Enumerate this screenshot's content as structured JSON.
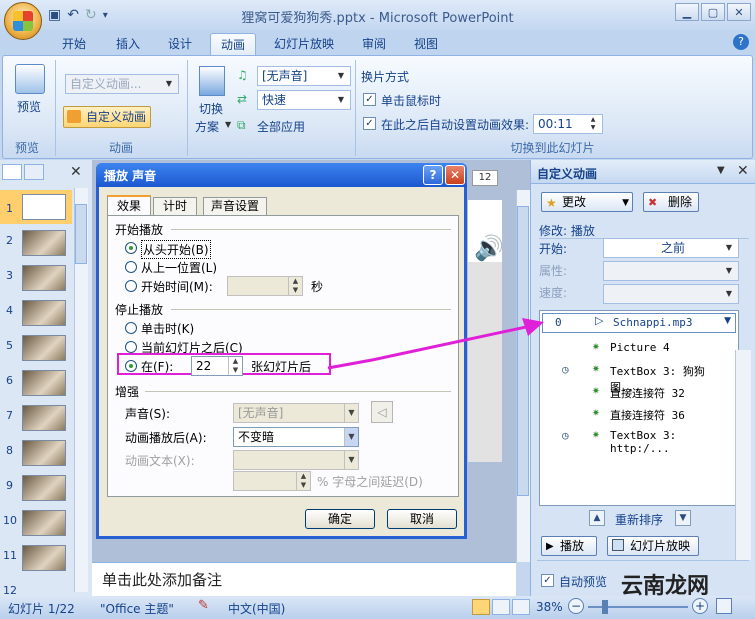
{
  "window": {
    "title": "狸窝可爱狗狗秀.pptx - Microsoft PowerPoint"
  },
  "tabs": [
    "开始",
    "插入",
    "设计",
    "动画",
    "幻灯片放映",
    "审阅",
    "视图"
  ],
  "ribbon": {
    "preview_label": "预览",
    "preview_group": "预览",
    "custom_anim_combo": "自定义动画...",
    "custom_anim_button": "自定义动画",
    "anim_group": "动画",
    "switch_scheme": "切换\n方案",
    "switch_label": "切换",
    "scheme_label": "方案",
    "sound_combo": "[无声音]",
    "speed_combo": "快速",
    "apply_all": "全部应用",
    "switch_mode_title": "换片方式",
    "on_click": "单击鼠标时",
    "auto_after": "在此之后自动设置动画效果:",
    "auto_time": "00:11",
    "transition_group": "切换到此幻灯片"
  },
  "slides_panel": {
    "numbers": [
      "1",
      "2",
      "3",
      "4",
      "5",
      "6",
      "7",
      "8",
      "9",
      "10",
      "11",
      "12"
    ],
    "slide_indicator": "12"
  },
  "notes_placeholder": "单击此处添加备注",
  "status": {
    "slide": "幻灯片 1/22",
    "theme": "\"Office 主题\"",
    "language": "中文(中国)",
    "zoom": "38%"
  },
  "watermark": "云南龙网",
  "dialog": {
    "title": "播放 声音",
    "tabs": [
      "效果",
      "计时",
      "声音设置"
    ],
    "start_group": "开始播放",
    "start_options": [
      "从头开始(B)",
      "从上一位置(L)",
      "开始时间(M):"
    ],
    "start_unit": "秒",
    "stop_group": "停止播放",
    "stop_options": [
      "单击时(K)",
      "当前幻灯片之后(C)",
      "在(F):"
    ],
    "stop_after_value": "22",
    "stop_after_unit": "张幻灯片后",
    "enhance_group": "增强",
    "sound_label": "声音(S):",
    "sound_value": "[无声音]",
    "after_anim_label": "动画播放后(A):",
    "after_anim_value": "不变暗",
    "anim_text_label": "动画文本(X):",
    "delay_label": "% 字母之间延迟(D)",
    "ok": "确定",
    "cancel": "取消"
  },
  "taskpane": {
    "title": "自定义动画",
    "change_btn": "更改",
    "delete_btn": "删除",
    "modify_label": "修改: 播放",
    "start_label": "开始:",
    "start_value": "之前",
    "property_label": "属性:",
    "speed_label": "速度:",
    "list": [
      {
        "num": "0",
        "text": "Schnappi.mp3"
      },
      {
        "num": "",
        "text": "Picture 4"
      },
      {
        "num": "",
        "text": "TextBox 3: 狗狗图..."
      },
      {
        "num": "",
        "text": "直接连接符 32"
      },
      {
        "num": "",
        "text": "直接连接符 36"
      },
      {
        "num": "",
        "text": "TextBox 3: http:/..."
      }
    ],
    "reorder_label": "重新排序",
    "play_btn": "播放",
    "slideshow_btn": "幻灯片放映",
    "auto_preview": "自动预览"
  }
}
